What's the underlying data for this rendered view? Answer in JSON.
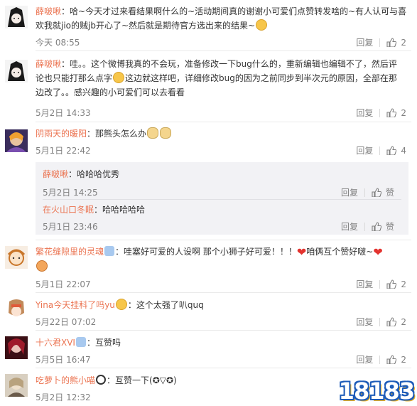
{
  "colors": {
    "username": "#eb7350",
    "meta": "#808080",
    "reply_bg": "#f2f2f5",
    "heart": "#e3332f"
  },
  "labels": {
    "reply": "回复",
    "like": "赞"
  },
  "comments": [
    {
      "user": "薛啵啾",
      "text1": "：哈~今天才过来看结果啊什么的~活动期间真的谢谢小可爱们点赞转发啥的~有人认可与喜",
      "text2": "欢我就jio的贼jb开心了~然后就是期待官方选出来的结果~",
      "time": "今天 08:55",
      "likes": "2"
    },
    {
      "user": "薛啵啾",
      "text1": "：哇。。这个微博我真的不会玩，准备修改一下bug什么的，重新编辑也编辑不了，然后评",
      "text2": "论也只能打那么点字",
      "text2b": "这边就这样吧，详细修改bug的因为之前同步到半次元的原因，全部在那",
      "text3": "边改了。。感兴趣的小可爱们可以去看看",
      "time": "5月2日 14:33",
      "likes": "2"
    },
    {
      "user": "阴雨天的暖阳",
      "text1": "：那熊头怎么办",
      "time": "5月1日 22:42",
      "likes": "4",
      "replies": [
        {
          "user": "薛啵啾",
          "text": "：哈哈哈优秀",
          "time": "5月2日 14:25",
          "like_label": "赞"
        },
        {
          "user": "在火山口冬眠",
          "text": "：哈哈哈哈哈",
          "time": "5月1日 23:46",
          "like_label": "赞"
        }
      ]
    },
    {
      "user": "繁花缝隙里的灵魂",
      "text1": "：哇塞好可爱的人设啊 那个小狮子好可爱！！！",
      "text1b": "咱俩互个赞好啵~",
      "time": "5月1日 22:07",
      "likes": "2"
    },
    {
      "user": "Yina今天挂科了吗yu",
      "text1": "：这个太强了叭quq",
      "time": "5月22日 07:02",
      "likes": "2"
    },
    {
      "user": "十六君XVI",
      "text1": "：互赞吗",
      "time": "5月5日 16:47",
      "likes": "2"
    },
    {
      "user": "吃萝卜的熊小喵",
      "text1": "：互赞一下(✪▽✪)",
      "time": "5月2日 12:32",
      "likes": "2"
    }
  ],
  "watermark": "18183"
}
